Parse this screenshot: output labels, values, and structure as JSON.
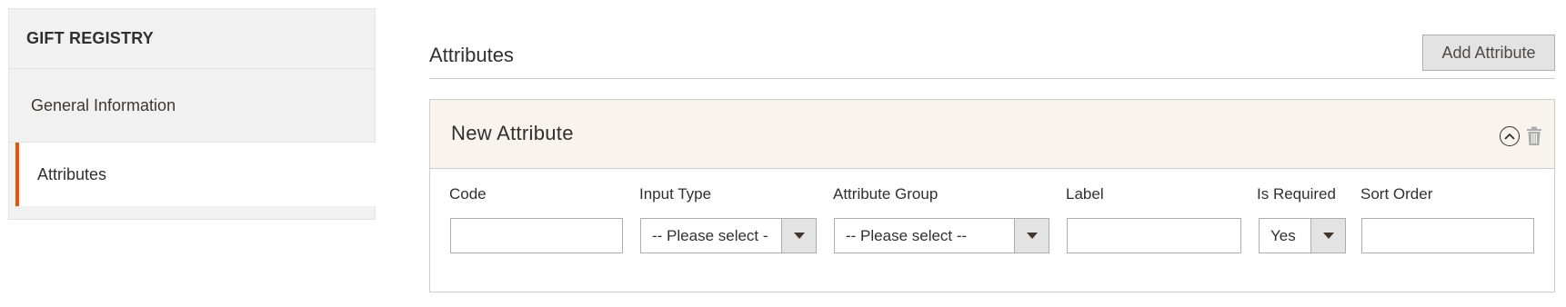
{
  "sidebar": {
    "title": "GIFT REGISTRY",
    "items": [
      {
        "label": "General Information",
        "active": false
      },
      {
        "label": "Attributes",
        "active": true
      }
    ]
  },
  "section": {
    "title": "Attributes",
    "add_button": "Add Attribute"
  },
  "attribute": {
    "title": "New Attribute",
    "fields": {
      "code": {
        "label": "Code",
        "value": ""
      },
      "input_type": {
        "label": "Input Type",
        "value": "-- Please select -"
      },
      "attribute_group": {
        "label": "Attribute Group",
        "value": "-- Please select --"
      },
      "label": {
        "label": "Label",
        "value": ""
      },
      "is_required": {
        "label": "Is Required",
        "value": "Yes"
      },
      "sort_order": {
        "label": "Sort Order",
        "value": ""
      }
    }
  },
  "colors": {
    "accent": "#eb5202",
    "panel_header_bg": "#f8f3ec",
    "sidebar_bg": "#f1f1f1"
  },
  "icons": [
    "collapse-icon",
    "trash-icon",
    "dropdown-arrow-icon"
  ]
}
